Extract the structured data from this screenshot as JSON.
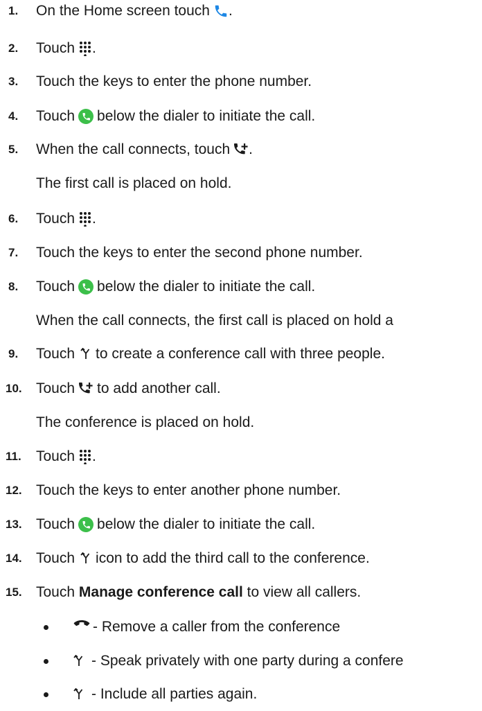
{
  "steps": [
    {
      "num": "1.",
      "before": "On the Home screen touch",
      "icon": "phone-handset-icon",
      "after": "."
    },
    {
      "num": "2.",
      "before": "Touch",
      "icon": "dialpad-icon",
      "after": "."
    },
    {
      "num": "3.",
      "before": "Touch the keys to enter the phone number.",
      "icon": "",
      "after": ""
    },
    {
      "num": "4.",
      "before": "Touch",
      "icon": "call-button-icon",
      "after": "below the dialer to initiate the call."
    },
    {
      "num": "5.",
      "before": "When the call connects, touch",
      "icon": "add-call-icon",
      "after": "."
    },
    {
      "note": "The first call is placed on hold."
    },
    {
      "num": "6.",
      "before": "Touch",
      "icon": "dialpad-icon",
      "after": "."
    },
    {
      "num": "7.",
      "before": "Touch the keys to enter the second phone number.",
      "icon": "",
      "after": ""
    },
    {
      "num": "8.",
      "before": "Touch",
      "icon": "call-button-icon",
      "after": "below the dialer to initiate the call."
    },
    {
      "note": "When the call connects, the first call is placed on hold a"
    },
    {
      "num": "9.",
      "before": "Touch",
      "icon": "merge-calls-icon",
      "after": "to create a conference call with three people."
    },
    {
      "num": "10.",
      "before": "Touch",
      "icon": "add-call-icon",
      "after": "to add another call."
    },
    {
      "note": "The conference is placed on hold."
    },
    {
      "num": "11.",
      "before": "Touch",
      "icon": "dialpad-icon",
      "after": "."
    },
    {
      "num": "12.",
      "before": "Touch the keys to enter another phone number.",
      "icon": "",
      "after": ""
    },
    {
      "num": "13.",
      "before": "Touch",
      "icon": "call-button-icon",
      "after": "below the dialer to initiate the call."
    },
    {
      "num": "14.",
      "before": "Touch",
      "icon": "merge-calls-icon",
      "after": "icon to add the third call to the conference."
    },
    {
      "num": "15.",
      "before": "Touch",
      "bold": "Manage conference call",
      "after": "to view all callers."
    }
  ],
  "bullets": [
    {
      "icon": "end-call-icon",
      "text": "- Remove a caller from the conference"
    },
    {
      "icon": "merge-calls-icon",
      "text": "- Speak privately with one party during a confere"
    },
    {
      "icon": "merge-calls-icon",
      "text": "- Include all parties again."
    }
  ],
  "colors": {
    "text": "#1a1a1a",
    "accent_blue": "#1e88e5",
    "call_green": "#3cbf4a"
  }
}
